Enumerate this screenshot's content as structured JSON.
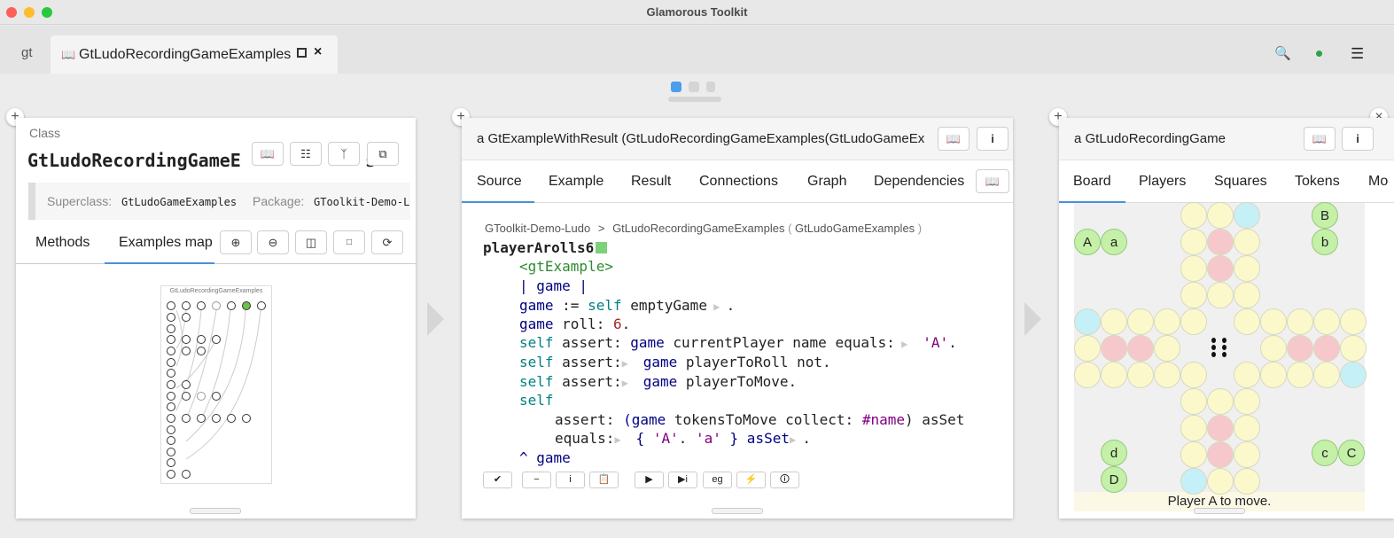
{
  "window": {
    "title": "Glamorous Toolkit"
  },
  "tabbar": {
    "logo": "gt",
    "tab_label": "GtLudoRecordingGameExamples"
  },
  "pane1": {
    "kind": "Class",
    "class_name": "GtLudoRecordingGameE",
    "class_name_tail": "s",
    "superclass_label": "Superclass:",
    "superclass": "GtLudoGameExamples",
    "package_label": "Package:",
    "package": "GToolkit-Demo-L",
    "tabs": [
      "Methods",
      "Examples map"
    ],
    "map_title": "GtLudoRecordingGameExamples"
  },
  "pane2": {
    "title": "a GtExampleWithResult (GtLudoRecordingGameExamples(GtLudoGameEx",
    "tabs": [
      "Source",
      "Example",
      "Result",
      "Connections",
      "Graph",
      "Dependencies"
    ],
    "bc_package": "GToolkit-Demo-Ludo",
    "bc_sep": ">",
    "bc_class": "GtLudoRecordingGameExamples",
    "bc_super": "GtLudoGameExamples",
    "method": "playerArolls6",
    "pragma": "<gtExample>",
    "temps": "| game |",
    "l1a": "game",
    "l1b": ":=",
    "l1c": "self",
    "l1d": "emptyGame",
    "l2a": "game",
    "l2b": "roll:",
    "l2c": "6",
    "l3a": "self",
    "l3b": "assert:",
    "l3c": "game",
    "l3d": "currentPlayer name equals:",
    "l3e": "'A'",
    "l4a": "self",
    "l4b": "assert:",
    "l4c": "game",
    "l4d": "playerToRoll not.",
    "l5a": "self",
    "l5b": "assert:",
    "l5c": "game",
    "l5d": "playerToMove.",
    "l6": "self",
    "l7a": "assert:",
    "l7b": "(game",
    "l7c": "tokensToMove collect:",
    "l7d": "#name",
    "l7e": ") asSet",
    "l8a": "equals:",
    "l8b": "{",
    "l8c": "'A'",
    "l8d": "'a'",
    "l8e": "} asSet",
    "l9a": "^",
    "l9b": "game",
    "buttons": [
      "✔",
      "−",
      "i",
      "📋",
      "▶",
      "▶i",
      "eg",
      "⚡",
      "🛈"
    ]
  },
  "pane3": {
    "title": "a GtLudoRecordingGame",
    "tabs": [
      "Board",
      "Players",
      "Squares",
      "Tokens",
      "Mo"
    ],
    "status": "Player A to move.",
    "tokens": [
      "A",
      "a",
      "B",
      "b",
      "c",
      "C",
      "d",
      "D"
    ]
  },
  "icons": [
    "book-icon",
    "info-icon",
    "search-icon",
    "menu-icon",
    "close-icon",
    "plus-icon"
  ]
}
